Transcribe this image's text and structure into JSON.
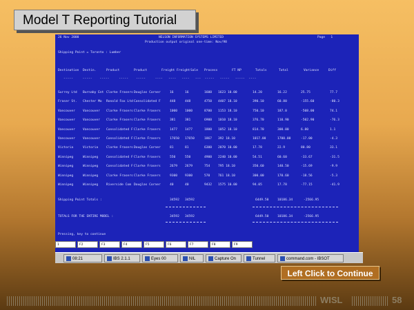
{
  "slide": {
    "title": "Model T Reporting Tutorial",
    "continue_label": "Left Click to Continue",
    "brand": "WISL",
    "page_number": "58"
  },
  "terminal": {
    "header_left": "26 Nov 2000",
    "header_center": "NELSON INFORMATION SYSTEMS LIMITED",
    "header_right": "Page   1",
    "report_title": "Production output original one-time: Nov/98",
    "subtitle": "Shipping Point = Toronto : Lumber",
    "columns": [
      "Destination",
      "Destin.",
      "Product",
      "Product",
      "Freight",
      "Freight",
      "Sale",
      "Process",
      "FT NP",
      "Totals",
      "Total",
      "Variance",
      "Diff"
    ],
    "column_rule": "-----     -----    -----     -----    -----     ----   ----   ----   ---  -----   -----   -----  ----",
    "rows": [
      [
        "Surrey Ltd",
        "Burnaby Ent",
        "Clarke Frasers",
        "Douglas Corner",
        "16",
        "16",
        "1600",
        "1623 10.00",
        "14.20",
        "16.22",
        "25.75",
        "77.7"
      ],
      [
        "Fraser St.",
        "Chester Mo",
        "Ronald Fox Ltd",
        "Consolidated F",
        "448",
        "448",
        "4750",
        "4407 18.10",
        "390.10",
        "60.80",
        "-155.60",
        "-80.3"
      ],
      [
        "Vancouver",
        "Vancouver",
        "Clarke Frasers",
        "Clarke Frasers",
        "1000",
        "1000",
        "8700",
        "1153 18.10",
        "750.10",
        "187.0",
        "-508.00",
        "74.1"
      ],
      [
        "Vancouver",
        "Vancouver",
        "Clarke Frasers",
        "Clarke Frasers",
        "381",
        "381",
        "6900",
        "1010 18.10",
        "376.70",
        "110.90",
        "-502.90",
        "-76.3"
      ],
      [
        "Vancouver",
        "Vancouver",
        "Consolidated F",
        "Clarke Frasers",
        "1477",
        "1477",
        "1800",
        "1052 18.10",
        "814.70",
        "300.00",
        "6.80",
        "1.1"
      ],
      [
        "Vancouver",
        "Vancouver",
        "Consolidated F",
        "Clarke Frasers",
        "17650",
        "17650",
        "1867",
        "392 18.10",
        "1017.00",
        "1700.00",
        "-17.00",
        "-4.3"
      ],
      [
        "Victoria",
        "Victoria",
        "Clarke Frasers",
        "Douglas Corner",
        "81",
        "81",
        "6300",
        "2070 10.00",
        "17.78",
        "22.9",
        "80.80",
        "33.1"
      ],
      [
        "Winnipeg",
        "Winnipeg",
        "Consolidated F",
        "Clarke Frasers",
        "550",
        "550",
        "4900",
        "2240 10.00",
        "54.51",
        "60.60",
        "-33.67",
        "-31.5"
      ],
      [
        "Winnipeg",
        "Winnipeg",
        "Consolidated F",
        "Clarke Frasers",
        "2679",
        "2679",
        "754",
        "795 18.10",
        "350.60",
        "140.50",
        "-15.69",
        "-9.9"
      ],
      [
        "Winnipeg",
        "Winnipeg",
        "Clarke Frasers",
        "Clarke Frasers",
        "9300",
        "9300",
        "570",
        "761 18.10",
        "300.00",
        "170.60",
        "-18.56",
        "-5.3"
      ],
      [
        "Winnipeg",
        "Winnipeg",
        "Riverside Com",
        "Douglas Corner",
        "40",
        "40",
        "9432",
        "1575 10.00",
        "94.05",
        "17.78",
        "-77.15",
        "-41.9"
      ]
    ],
    "subtotal_label": "Shipping Point Totals :",
    "subtotal_values": [
      "34592",
      "34592",
      "6449.50",
      "10186.34",
      "-2566.95"
    ],
    "grand_total_label": "TOTALS FOR THE ENTIRE MODEL :",
    "grand_total_values": [
      "34592",
      "34592",
      "6449.50",
      "10186.34",
      "-2566.95"
    ],
    "prompt": "Pressing, key to continue",
    "fkeys": [
      "1",
      "F2",
      "F3",
      "F4",
      "F5",
      "F6",
      "F7",
      "F8",
      "F9"
    ]
  },
  "taskbar": {
    "items": [
      {
        "label": "08:21",
        "icon": "app-icon"
      },
      {
        "label": "IBS 2.1.1",
        "icon": "terminal-icon"
      },
      {
        "label": "Eyes 00",
        "icon": "window-icon"
      },
      {
        "label": "NIL",
        "icon": "document-icon"
      },
      {
        "label": "Capture On",
        "icon": "camera-icon"
      },
      {
        "label": "Tunnel",
        "icon": "network-icon"
      },
      {
        "label": "command.com - IBSOT",
        "icon": "console-icon"
      }
    ]
  }
}
